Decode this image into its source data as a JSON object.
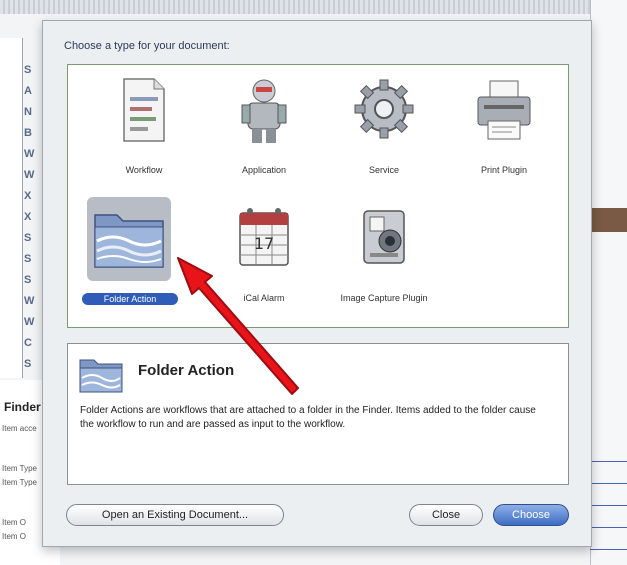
{
  "dialog": {
    "title": "Choose a type for your document:",
    "templates": [
      {
        "label": "Workflow",
        "icon": "workflow-icon"
      },
      {
        "label": "Application",
        "icon": "application-robot-icon"
      },
      {
        "label": "Service",
        "icon": "service-gear-icon"
      },
      {
        "label": "Print Plugin",
        "icon": "printer-icon"
      },
      {
        "label": "Folder Action",
        "icon": "folder-action-icon",
        "selected": true
      },
      {
        "label": "iCal Alarm",
        "icon": "calendar-alarm-icon"
      },
      {
        "label": "Image Capture Plugin",
        "icon": "camera-icon"
      }
    ],
    "description": {
      "title": "Folder Action",
      "text": "Folder Actions are workflows that are attached to a folder in the Finder. Items added to the folder cause the workflow to run and are passed as input to the workflow."
    },
    "buttons": {
      "open_existing": "Open an Existing Document...",
      "close": "Close",
      "choose": "Choose"
    }
  },
  "background": {
    "left_letters": [
      "S",
      "A",
      "N",
      "B",
      "W",
      "W",
      "X",
      "X",
      "S",
      "S",
      "S",
      "W",
      "W",
      "C",
      "S",
      "W"
    ],
    "bottom_left_title": "Finder",
    "bottom_left_lines": [
      "Item acce",
      "Item Type",
      "Item Type",
      "Item O",
      "Item O"
    ]
  },
  "colors": {
    "selection": "#2e5cb8",
    "annotation_arrow": "#e8141a",
    "panel_border": "#7a9c6e"
  }
}
